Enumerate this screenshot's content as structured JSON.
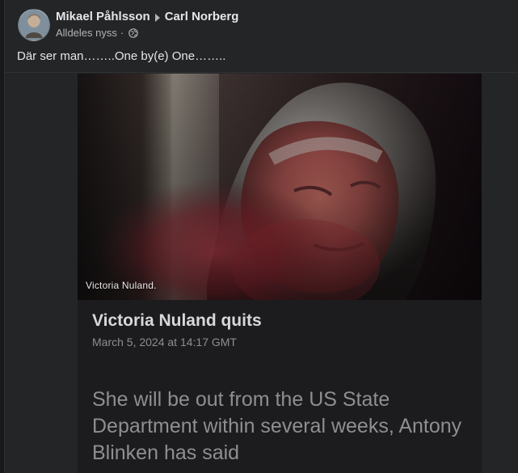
{
  "post": {
    "author": "Mikael Påhlsson",
    "target": "Carl Norberg",
    "time": "Alldeles nyss",
    "separator": "·",
    "text": "Där ser man……..One by(e) One…….."
  },
  "media": {
    "caption": "Victoria Nuland.",
    "headline": "Victoria Nuland quits",
    "timestamp": "March 5, 2024 at 14:17 GMT",
    "lead": "She will be out from the US State Department within several weeks, Antony Blinken has said"
  },
  "icons": {
    "audience": "globe-icon",
    "arrow": "arrow-right-icon",
    "avatar": "profile-photo"
  },
  "colors": {
    "background": "#242526",
    "primary_text": "#e4e6eb",
    "secondary_text": "#b0b3b8",
    "article_background": "#1c1c1e"
  }
}
